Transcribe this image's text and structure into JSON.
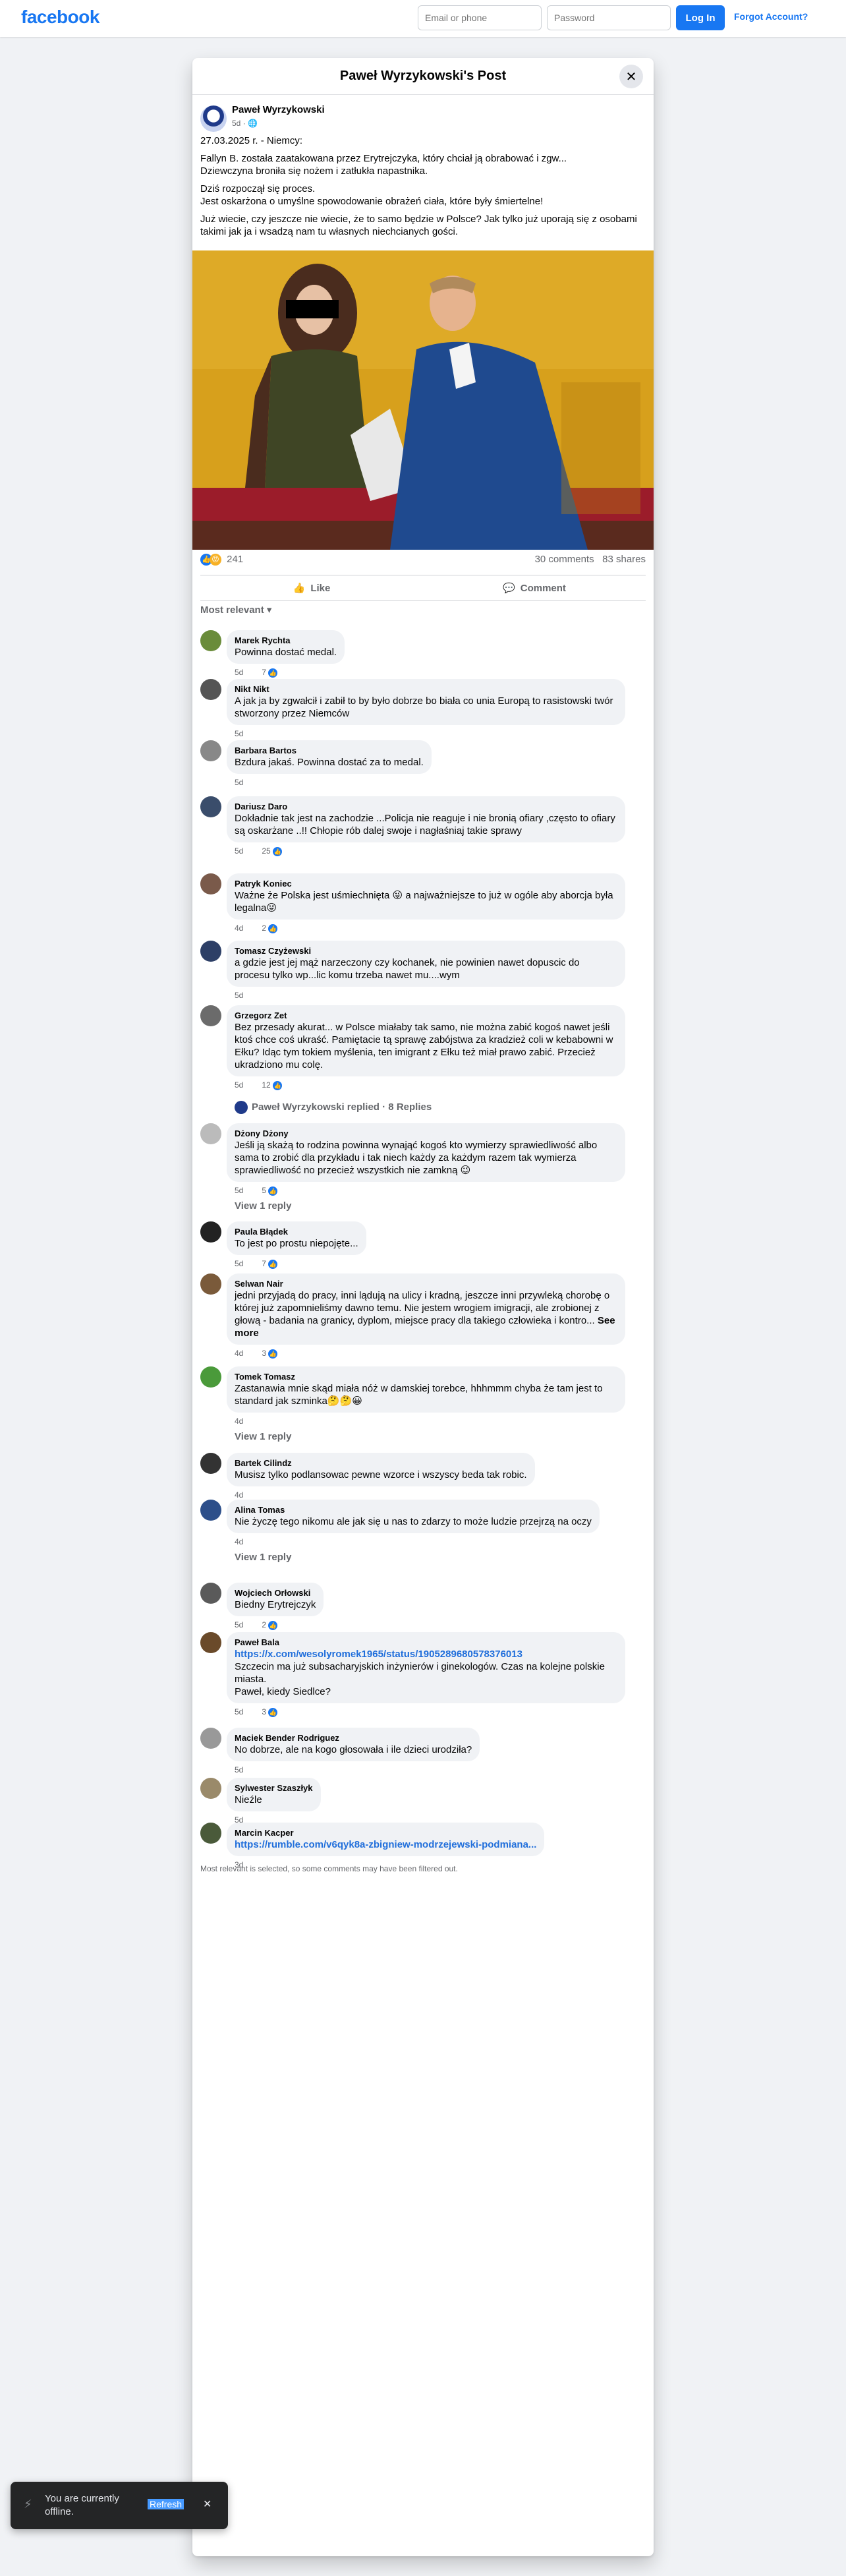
{
  "topbar": {
    "logo": "facebook",
    "email_placeholder": "Email or phone",
    "password_placeholder": "Password",
    "login_label": "Log In",
    "forgot_label": "Forgot Account?"
  },
  "modal": {
    "title": "Paweł Wyrzykowski's Post"
  },
  "post": {
    "author": "Paweł Wyrzykowski",
    "time": "5d",
    "line1": "27.03.2025 r. - Niemcy:",
    "line2": "Fallyn B. została zaatakowana przez Erytrejczyka, który chciał ją obrabować i zgw...",
    "line3": "Dziewczyna broniła się nożem i zatłukła napastnika.",
    "line4": "Dziś rozpoczął się proces.",
    "line5": "Jest oskarżona o umyślne spowodowanie obrażeń ciała, które były śmiertelne!",
    "line6": "Już wiecie, czy jeszcze nie wiecie, że to samo będzie w Polsce? Jak tylko już uporają się z osobami takimi jak ja i wsadzą nam tu własnych niechcianych gości.",
    "reactions_count": "241",
    "comments_count": "30 comments",
    "shares_count": "83 shares",
    "like_label": "Like",
    "comment_label": "Comment",
    "sort_label": "Most relevant"
  },
  "comments": [
    {
      "name": "Marek Rychta",
      "text": "Powinna dostać medal.",
      "time": "5d",
      "reacts": "7"
    },
    {
      "name": "Nikt Nikt",
      "text": "A jak ja by zgwałcił i zabił to by było dobrze bo biała co unia Europą to rasistowski twór stworzony przez Niemców",
      "time": "5d",
      "reacts": ""
    },
    {
      "name": "Barbara Bartos",
      "text": "Bzdura jakaś. Powinna dostać za to medal.",
      "time": "5d",
      "reacts": ""
    },
    {
      "name": "Dariusz Daro",
      "text": "Dokładnie tak jest na zachodzie ...Policja nie reaguje i nie bronią ofiary ,często to ofiary są oskarżane ..!! Chłopie rób dalej swoje i nagłaśniaj takie sprawy",
      "time": "5d",
      "reacts": "25"
    },
    {
      "name": "Patryk Koniec",
      "text": "Ważne że Polska jest uśmiechnięta 😜 a najważniejsze to już w ogóle aby aborcja była legalna😜",
      "time": "4d",
      "reacts": "2"
    },
    {
      "name": "Tomasz Czyżewski",
      "text": "a gdzie jest jej mąż narzeczony czy kochanek, nie powinien nawet dopuscic do procesu tylko wp...lic komu trzeba nawet mu....wym",
      "time": "5d",
      "reacts": ""
    },
    {
      "name": "Grzegorz Zet",
      "text": "Bez przesady akurat... w Polsce miałaby tak samo, nie można zabić kogoś nawet jeśli ktoś chce coś ukraść. Pamiętacie tą sprawę zabójstwa za kradzież coli w kebabowni w Ełku? Idąc tym tokiem myślenia, ten imigrant z Ełku też miał prawo zabić. Przecież ukradziono mu colę.",
      "time": "5d",
      "reacts": "12"
    },
    {
      "replied": "Paweł Wyrzykowski replied · 8 Replies"
    },
    {
      "name": "Dżony Dżony",
      "text": "Jeśli ją skażą to rodzina powinna wynająć kogoś kto wymierzy sprawiedliwość albo sama to zrobić dla przykładu i tak niech każdy za każdym razem tak wymierza sprawiedliwość no przecież wszystkich nie zamkną 😉",
      "time": "5d",
      "reacts": "5",
      "view_reply": "View 1 reply"
    },
    {
      "name": "Paula Błądek",
      "text": "To jest po prostu niepojęte...",
      "time": "5d",
      "reacts": "7"
    },
    {
      "name": "Selwan Nair",
      "text": "jedni przyjadą do pracy, inni lądują na ulicy i kradną, jeszcze inni przywleką chorobę o której już zapomnieliśmy dawno temu. Nie jestem wrogiem imigracji, ale zrobionej z głową - badania na granicy, dyplom, miejsce pracy dla takiego człowieka i kontro...",
      "see_more": "See more",
      "time": "4d",
      "reacts": "3"
    },
    {
      "name": "Tomek Tomasz",
      "text": "Zastanawia mnie skąd miała nóż w damskiej torebce, hhhmmm chyba że tam jest to standard jak szminka🤔🤔😀",
      "time": "4d",
      "reacts": "",
      "view_reply": "View 1 reply"
    },
    {
      "name": "Bartek Cilindz",
      "text": "Musisz tylko podlansowac pewne wzorce i wszyscy beda tak robic.",
      "time": "4d",
      "reacts": ""
    },
    {
      "name": "Alina Tomas",
      "text": "Nie życzę tego nikomu ale jak się u nas to zdarzy to może ludzie przejrzą na oczy",
      "time": "4d",
      "reacts": "",
      "view_reply": "View 1 reply"
    },
    {
      "name": "Wojciech Orłowski",
      "text": "Biedny Erytrejczyk",
      "time": "5d",
      "reacts": "2"
    },
    {
      "name": "Paweł Bala",
      "link": "https://x.com/wesolyromek1965/status/1905289680578376013",
      "text": "Szczecin ma już subsacharyjskich inżynierów i ginekologów. Czas na kolejne polskie miasta.",
      "text2": "Paweł, kiedy Siedlce?",
      "time": "5d",
      "reacts": "3"
    },
    {
      "name": "Maciek Bender Rodriguez",
      "text": "No dobrze, ale na kogo głosowała i ile dzieci urodziła?",
      "time": "5d",
      "reacts": ""
    },
    {
      "name": "Sylwester Szaszłyk",
      "text": "Nieźle",
      "time": "5d",
      "reacts": ""
    },
    {
      "name": "Marcin Kacper",
      "link": "https://rumble.com/v6qyk8a-zbigniew-modrzejewski-podmiana...",
      "time": "3d",
      "reacts": ""
    }
  ],
  "footer_note": "Most relevant is selected, so some comments may have been filtered out.",
  "offline": {
    "text": "You are currently offline.",
    "refresh": "Refresh"
  }
}
